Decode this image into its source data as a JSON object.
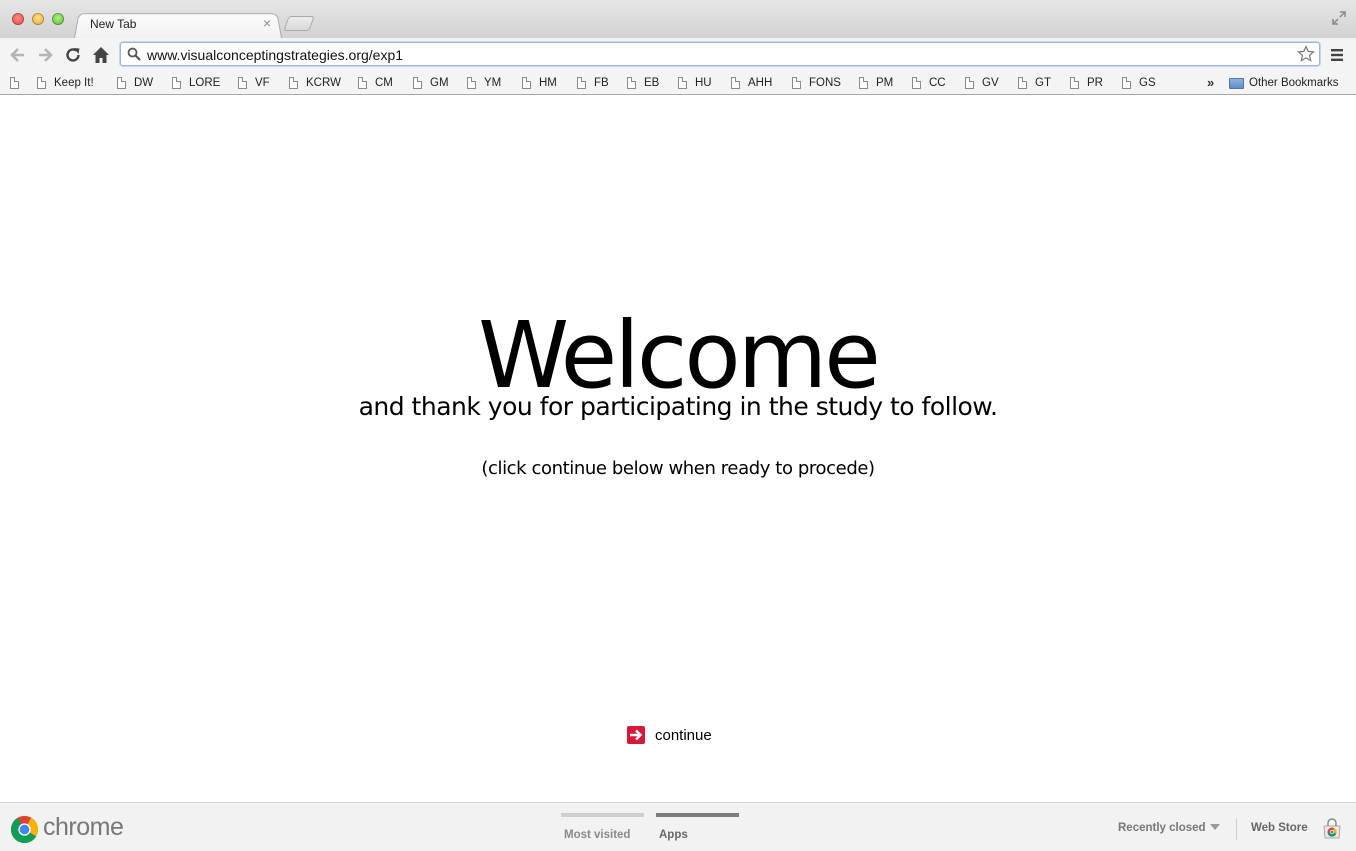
{
  "browser": {
    "tab_title": "New Tab",
    "tab_close_glyph": "×",
    "url": "www.visualconceptingstrategies.org/exp1"
  },
  "bookmarks": {
    "items": [
      {
        "label": ""
      },
      {
        "label": "Keep It!"
      },
      {
        "label": "DW"
      },
      {
        "label": "LORE"
      },
      {
        "label": "VF"
      },
      {
        "label": "KCRW"
      },
      {
        "label": "CM"
      },
      {
        "label": "GM"
      },
      {
        "label": "YM"
      },
      {
        "label": "HM"
      },
      {
        "label": "FB"
      },
      {
        "label": "EB"
      },
      {
        "label": "HU"
      },
      {
        "label": "AHH"
      },
      {
        "label": "FONS"
      },
      {
        "label": "PM"
      },
      {
        "label": "CC"
      },
      {
        "label": "GV"
      },
      {
        "label": "GT"
      },
      {
        "label": "PR"
      },
      {
        "label": "GS"
      }
    ],
    "overflow_glyph": "»",
    "other_folder": "Other Bookmarks"
  },
  "page": {
    "heading": "Welcome",
    "subheading": "and thank you for participating in the study to follow.",
    "instruction": "(click continue below when ready to procede)",
    "continue_label": "continue",
    "accent_color": "#d8183a"
  },
  "footer": {
    "brand": "chrome",
    "tabs": {
      "most_visited": "Most visited",
      "apps": "Apps"
    },
    "recently_closed": "Recently closed",
    "web_store": "Web Store"
  },
  "icons": {
    "back": "back-arrow-icon",
    "forward": "forward-arrow-icon",
    "reload": "reload-icon",
    "home": "home-icon",
    "search": "search-icon",
    "star": "star-icon",
    "menu": "menu-icon",
    "fullscreen": "fullscreen-icon",
    "continue": "arrow-right-icon",
    "chrome_logo": "chrome-logo-icon",
    "web_store": "web-store-icon"
  }
}
